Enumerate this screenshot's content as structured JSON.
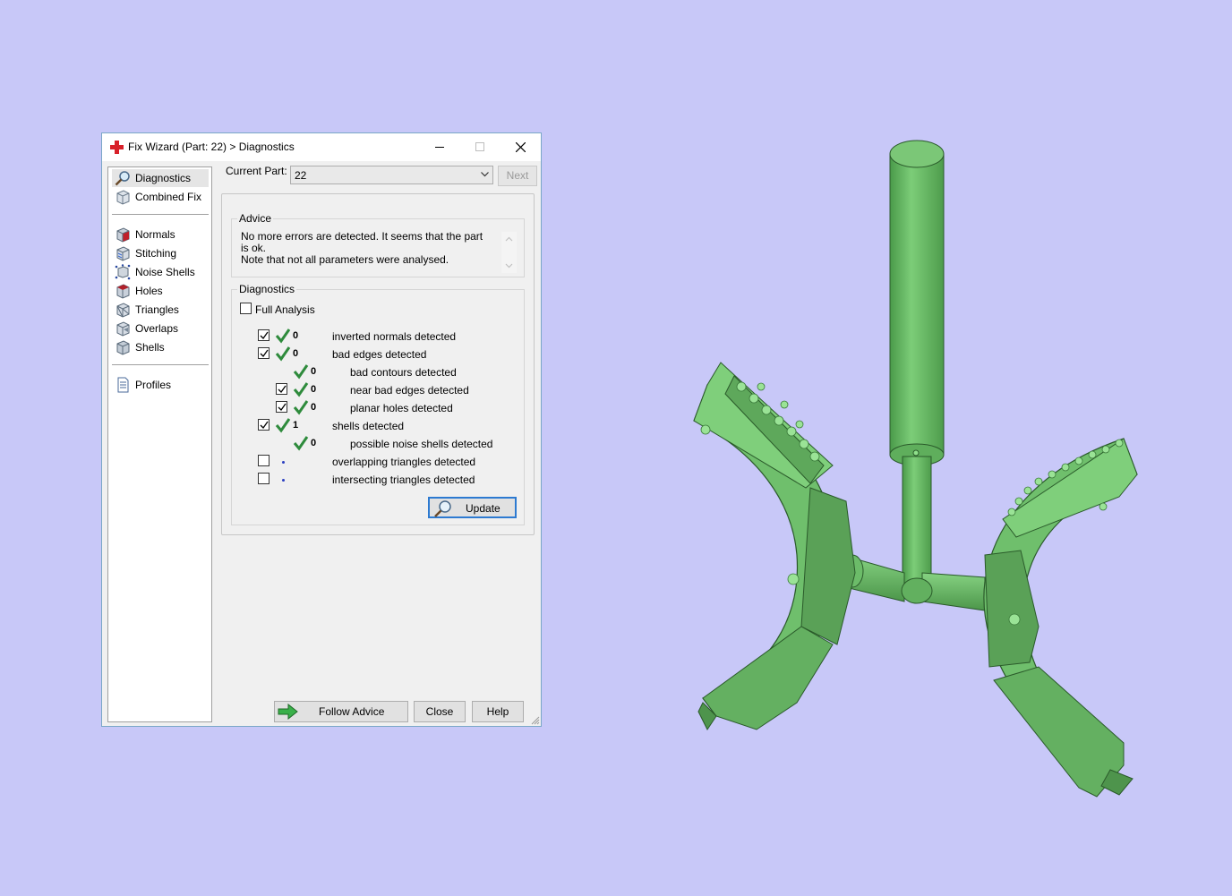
{
  "window": {
    "title": "Fix Wizard (Part: 22) > Diagnostics",
    "controls": {
      "minimize": "minimize",
      "maximize": "maximize",
      "close": "close"
    }
  },
  "sidebar": {
    "items": [
      {
        "label": "Diagnostics",
        "icon": "magnifier-icon",
        "selected": true
      },
      {
        "label": "Combined Fix",
        "icon": "cube-gray-icon"
      },
      {
        "label": "Normals",
        "icon": "cube-red-icon"
      },
      {
        "label": "Stitching",
        "icon": "cube-stitch-icon"
      },
      {
        "label": "Noise Shells",
        "icon": "cube-dots-icon"
      },
      {
        "label": "Holes",
        "icon": "cube-hole-icon"
      },
      {
        "label": "Triangles",
        "icon": "cube-triangles-icon"
      },
      {
        "label": "Overlaps",
        "icon": "cube-overlap-icon"
      },
      {
        "label": "Shells",
        "icon": "cube-shell-icon"
      },
      {
        "label": "Profiles",
        "icon": "document-icon"
      }
    ]
  },
  "current_part": {
    "label": "Current Part:",
    "value": "22"
  },
  "next_button": "Next",
  "advice": {
    "group_label": "Advice",
    "line1": "No more errors are detected. It seems that the part is ok.",
    "line2": "Note that not all parameters were analysed."
  },
  "diagnostics": {
    "group_label": "Diagnostics",
    "full_analysis_label": "Full Analysis",
    "rows": [
      {
        "checked": true,
        "status": "ok",
        "count": "0",
        "label": "inverted normals detected",
        "indent": 0
      },
      {
        "checked": true,
        "status": "ok",
        "count": "0",
        "label": "bad edges detected",
        "indent": 0
      },
      {
        "checked": null,
        "status": "ok",
        "count": "0",
        "label": "bad contours detected",
        "indent": 1
      },
      {
        "checked": true,
        "status": "ok",
        "count": "0",
        "label": "near bad edges detected",
        "indent": 1
      },
      {
        "checked": true,
        "status": "ok",
        "count": "0",
        "label": "planar holes detected",
        "indent": 1
      },
      {
        "checked": true,
        "status": "ok",
        "count": "1",
        "label": "shells detected",
        "indent": 0
      },
      {
        "checked": null,
        "status": "ok",
        "count": "0",
        "label": "possible noise shells detected",
        "indent": 1
      },
      {
        "checked": false,
        "status": "pending",
        "count": "",
        "label": "overlapping triangles detected",
        "indent": 0
      },
      {
        "checked": false,
        "status": "pending",
        "count": "",
        "label": "intersecting triangles detected",
        "indent": 0
      }
    ],
    "update_button": "Update"
  },
  "buttons": {
    "follow_advice": "Follow Advice",
    "close": "Close",
    "help": "Help"
  },
  "colors": {
    "background": "#c8c8f8",
    "model_green": "#6cb86a",
    "check_green": "#2e8b3c",
    "accent_blue": "#2d7ad1"
  }
}
